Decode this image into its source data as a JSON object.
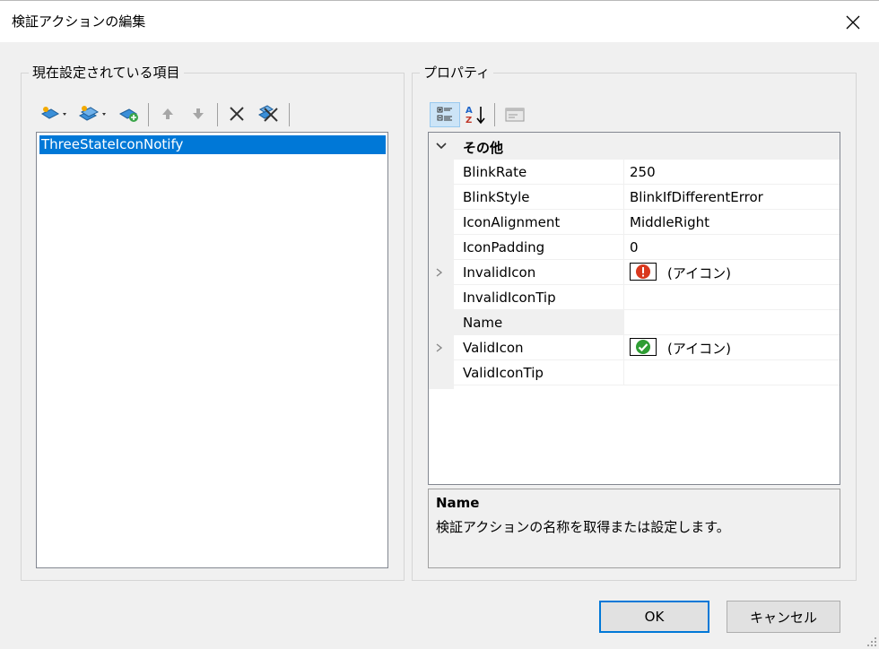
{
  "window": {
    "title": "検証アクションの編集",
    "close_icon": "close-icon"
  },
  "left_panel": {
    "label": "現在設定されている項目",
    "toolbar": [
      "add-dropdown-icon",
      "add-multi-dropdown-icon",
      "add-child-icon",
      "move-up-icon",
      "move-down-icon",
      "delete-icon",
      "delete-all-icon"
    ],
    "items": [
      "ThreeStateIconNotify"
    ],
    "selected_index": 0
  },
  "right_panel": {
    "label": "プロパティ",
    "toolbar": [
      "categorized-icon",
      "alphabetical-icon",
      "property-pages-icon"
    ],
    "category": "その他",
    "properties": [
      {
        "name": "BlinkRate",
        "value": "250"
      },
      {
        "name": "BlinkStyle",
        "value": "BlinkIfDifferentError"
      },
      {
        "name": "IconAlignment",
        "value": "MiddleRight"
      },
      {
        "name": "IconPadding",
        "value": "0"
      },
      {
        "name": "InvalidIcon",
        "value": "(アイコン)",
        "expandable": true,
        "icon": "error-icon"
      },
      {
        "name": "InvalidIconTip",
        "value": ""
      },
      {
        "name": "Name",
        "value": "",
        "selected": true
      },
      {
        "name": "ValidIcon",
        "value": "(アイコン)",
        "expandable": true,
        "icon": "check-icon"
      },
      {
        "name": "ValidIconTip",
        "value": ""
      }
    ],
    "description": {
      "title": "Name",
      "text": "検証アクションの名称を取得または設定します。"
    }
  },
  "buttons": {
    "ok": "OK",
    "cancel": "キャンセル"
  },
  "colors": {
    "selection": "#0078d7",
    "error_icon": "#d9381e",
    "check_icon": "#2e9d33"
  }
}
